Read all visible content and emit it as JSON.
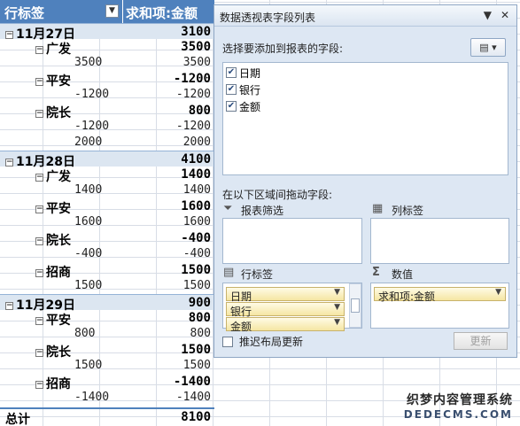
{
  "pivot": {
    "header_rows": "行标签",
    "header_values": "求和项:金额",
    "dates": [
      {
        "label": "11月27日",
        "total": "3100",
        "banks": [
          {
            "label": "广发",
            "total": "3500",
            "items": [
              {
                "label": "3500",
                "value": "3500"
              }
            ]
          },
          {
            "label": "平安",
            "total": "-1200",
            "items": [
              {
                "label": "-1200",
                "value": "-1200"
              }
            ]
          },
          {
            "label": "院长",
            "total": "800",
            "items": [
              {
                "label": "-1200",
                "value": "-1200"
              },
              {
                "label": "2000",
                "value": "2000"
              }
            ]
          }
        ]
      },
      {
        "label": "11月28日",
        "total": "4100",
        "banks": [
          {
            "label": "广发",
            "total": "1400",
            "items": [
              {
                "label": "1400",
                "value": "1400"
              }
            ]
          },
          {
            "label": "平安",
            "total": "1600",
            "items": [
              {
                "label": "1600",
                "value": "1600"
              }
            ]
          },
          {
            "label": "院长",
            "total": "-400",
            "items": [
              {
                "label": "-400",
                "value": "-400"
              }
            ]
          },
          {
            "label": "招商",
            "total": "1500",
            "items": [
              {
                "label": "1500",
                "value": "1500"
              }
            ]
          }
        ]
      },
      {
        "label": "11月29日",
        "total": "900",
        "banks": [
          {
            "label": "平安",
            "total": "800",
            "items": [
              {
                "label": "800",
                "value": "800"
              }
            ]
          },
          {
            "label": "院长",
            "total": "1500",
            "items": [
              {
                "label": "1500",
                "value": "1500"
              }
            ]
          },
          {
            "label": "招商",
            "total": "-1400",
            "items": [
              {
                "label": "-1400",
                "value": "-1400"
              }
            ]
          }
        ]
      }
    ],
    "grand_total_label": "总计",
    "grand_total_value": "8100"
  },
  "panel": {
    "title": "数据透视表字段列表",
    "choose_fields_label": "选择要添加到报表的字段:",
    "fields": [
      {
        "label": "日期",
        "checked": true
      },
      {
        "label": "银行",
        "checked": true
      },
      {
        "label": "金额",
        "checked": true
      }
    ],
    "drag_label": "在以下区域间拖动字段:",
    "report_filter_label": "报表筛选",
    "column_labels_label": "列标签",
    "row_labels_label": "行标签",
    "values_label": "数值",
    "row_pills": [
      "日期",
      "银行",
      "金额"
    ],
    "value_pills": [
      "求和项:金额"
    ],
    "defer_label": "推迟布局更新",
    "update_button": "更新"
  },
  "watermark": {
    "line1": "织梦内容管理系统",
    "line2": "DEDECMS.COM"
  }
}
